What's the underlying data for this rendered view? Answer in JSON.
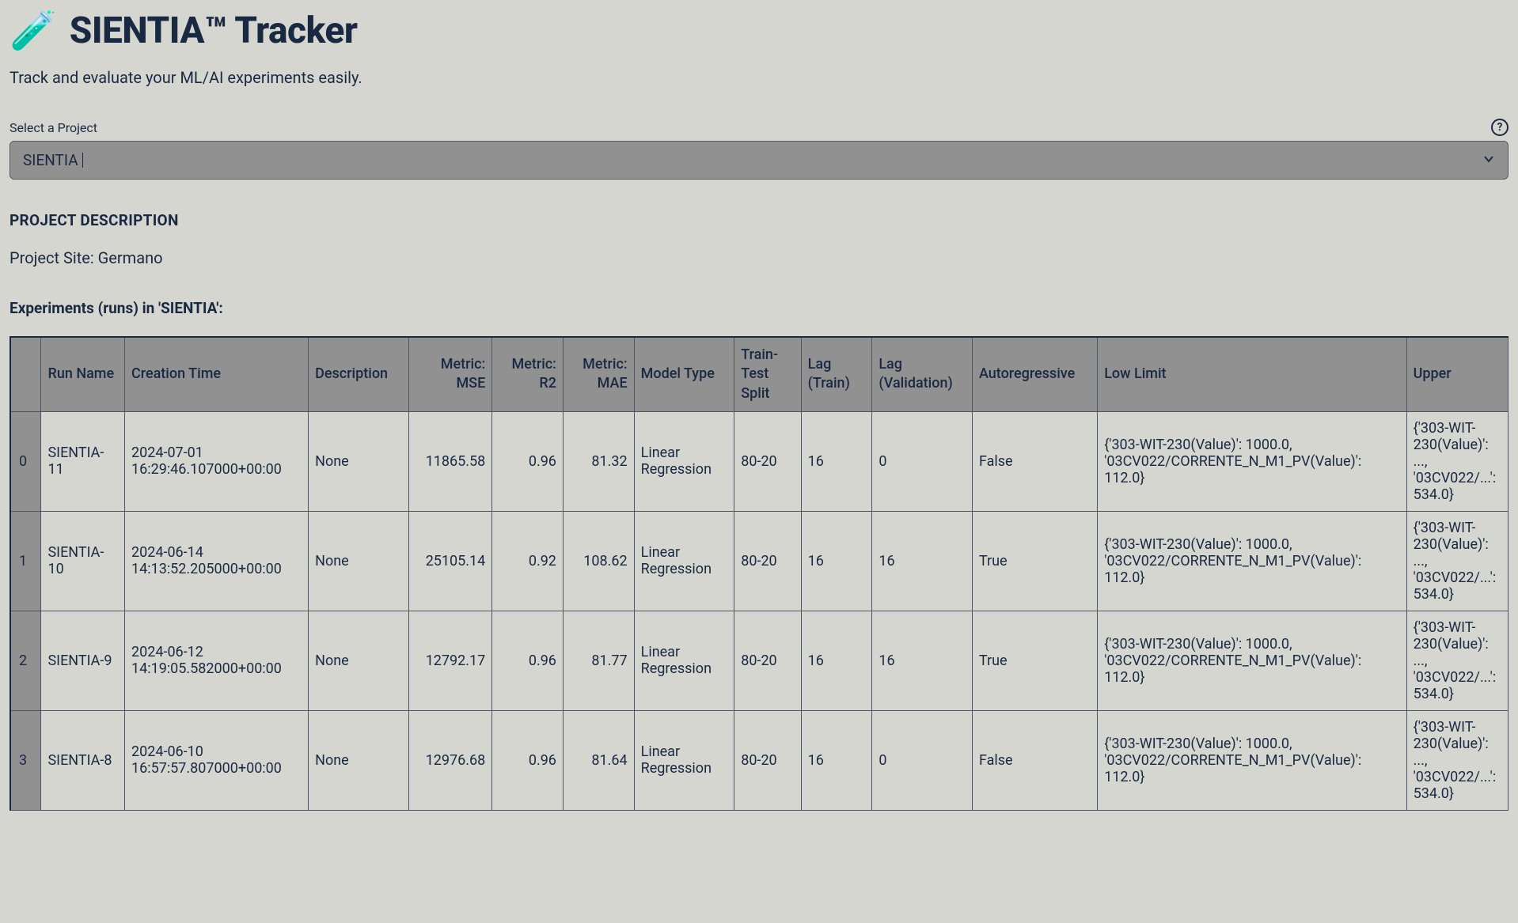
{
  "header": {
    "title": "SIENTIA™ Tracker",
    "icon": "🧪",
    "subtitle": "Track and evaluate your ML/AI experiments easily."
  },
  "selector": {
    "label": "Select a Project",
    "value": "SIENTIA",
    "help": "?"
  },
  "project": {
    "heading": "PROJECT DESCRIPTION",
    "site": "Project Site: Germano"
  },
  "experiments": {
    "heading": "Experiments (runs) in 'SIENTIA':",
    "columns": {
      "idx": "",
      "run_name": "Run Name",
      "creation_time": "Creation Time",
      "description": "Description",
      "metric_mse": "Metric: MSE",
      "metric_r2": "Metric: R2",
      "metric_mae": "Metric: MAE",
      "model_type": "Model Type",
      "train_test_split": "Train-Test Split",
      "lag_train": "Lag (Train)",
      "lag_validation": "Lag (Validation)",
      "autoregressive": "Autoregressive",
      "low_limit": "Low Limit",
      "upper": "Upper"
    },
    "rows": [
      {
        "idx": "0",
        "run_name": "SIENTIA-11",
        "creation_time": "2024-07-01 16:29:46.107000+00:00",
        "description": "None",
        "metric_mse": "11865.58",
        "metric_r2": "0.96",
        "metric_mae": "81.32",
        "model_type": "Linear Regression",
        "train_test_split": "80-20",
        "lag_train": "16",
        "lag_validation": "0",
        "autoregressive": "False",
        "low_limit": "{'303-WIT-230(Value)': 1000.0, '03CV022/CORRENTE_N_M1_PV(Value)': 112.0}",
        "upper": "{'303-WIT-230(Value)': ..., '03CV022/...': 534.0}"
      },
      {
        "idx": "1",
        "run_name": "SIENTIA-10",
        "creation_time": "2024-06-14 14:13:52.205000+00:00",
        "description": "None",
        "metric_mse": "25105.14",
        "metric_r2": "0.92",
        "metric_mae": "108.62",
        "model_type": "Linear Regression",
        "train_test_split": "80-20",
        "lag_train": "16",
        "lag_validation": "16",
        "autoregressive": "True",
        "low_limit": "{'303-WIT-230(Value)': 1000.0, '03CV022/CORRENTE_N_M1_PV(Value)': 112.0}",
        "upper": "{'303-WIT-230(Value)': ..., '03CV022/...': 534.0}"
      },
      {
        "idx": "2",
        "run_name": "SIENTIA-9",
        "creation_time": "2024-06-12 14:19:05.582000+00:00",
        "description": "None",
        "metric_mse": "12792.17",
        "metric_r2": "0.96",
        "metric_mae": "81.77",
        "model_type": "Linear Regression",
        "train_test_split": "80-20",
        "lag_train": "16",
        "lag_validation": "16",
        "autoregressive": "True",
        "low_limit": "{'303-WIT-230(Value)': 1000.0, '03CV022/CORRENTE_N_M1_PV(Value)': 112.0}",
        "upper": "{'303-WIT-230(Value)': ..., '03CV022/...': 534.0}"
      },
      {
        "idx": "3",
        "run_name": "SIENTIA-8",
        "creation_time": "2024-06-10 16:57:57.807000+00:00",
        "description": "None",
        "metric_mse": "12976.68",
        "metric_r2": "0.96",
        "metric_mae": "81.64",
        "model_type": "Linear Regression",
        "train_test_split": "80-20",
        "lag_train": "16",
        "lag_validation": "0",
        "autoregressive": "False",
        "low_limit": "{'303-WIT-230(Value)': 1000.0, '03CV022/CORRENTE_N_M1_PV(Value)': 112.0}",
        "upper": "{'303-WIT-230(Value)': ..., '03CV022/...': 534.0}"
      }
    ]
  }
}
